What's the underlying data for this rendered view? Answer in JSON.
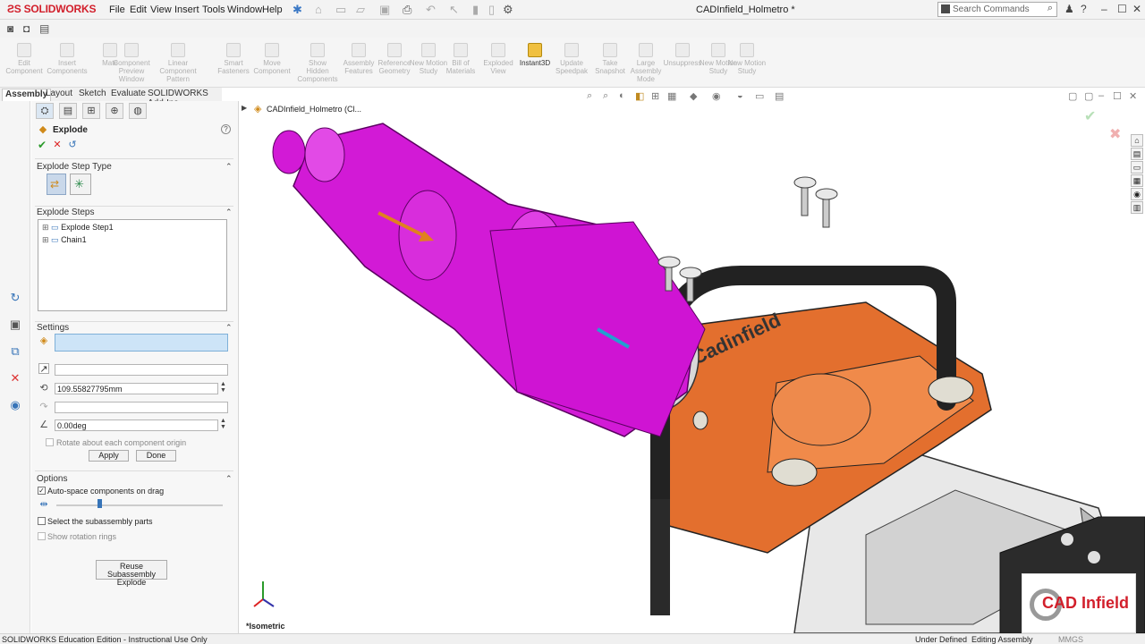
{
  "app": {
    "brand": "SOLIDWORKS",
    "menu": [
      "File",
      "Edit",
      "View",
      "Insert",
      "Tools",
      "Window",
      "Help"
    ],
    "doc_title": "CADInfield_Holmetro *",
    "search_placeholder": "Search Commands"
  },
  "command_bar": [
    {
      "label": "Edit Component",
      "active": false
    },
    {
      "label": "Insert Components",
      "active": false
    },
    {
      "label": "Mate",
      "active": false
    },
    {
      "label": "Component Preview Window",
      "active": false
    },
    {
      "label": "Linear Component Pattern",
      "active": false
    },
    {
      "label": "Smart Fasteners",
      "active": false
    },
    {
      "label": "Move Component",
      "active": false
    },
    {
      "label": "Show Hidden Components",
      "active": false
    },
    {
      "label": "Assembly Features",
      "active": false
    },
    {
      "label": "Reference Geometry",
      "active": false
    },
    {
      "label": "New Motion Study",
      "active": false
    },
    {
      "label": "Bill of Materials",
      "active": false
    },
    {
      "label": "Exploded View",
      "active": false
    },
    {
      "label": "Instant3D",
      "active": true
    },
    {
      "label": "Update Speedpak",
      "active": false
    },
    {
      "label": "Take Snapshot",
      "active": false
    },
    {
      "label": "Large Assembly Mode",
      "active": false
    },
    {
      "label": "Unsuppress",
      "active": false
    },
    {
      "label": "New Motion Study",
      "active": false
    },
    {
      "label": "New Motion Study",
      "active": false
    }
  ],
  "tabs": [
    "Assembly",
    "Layout",
    "Sketch",
    "Evaluate",
    "SOLIDWORKS Add-Ins"
  ],
  "property_manager": {
    "title": "Explode",
    "step_type_header": "Explode Step Type",
    "steps_header": "Explode Steps",
    "steps": [
      "Explode Step1",
      "Chain1"
    ],
    "settings_header": "Settings",
    "distance": "109.55827795mm",
    "angle": "0.00deg",
    "rotate_label": "Rotate about each component origin",
    "apply": "Apply",
    "done": "Done",
    "options_header": "Options",
    "auto_space": "Auto-space components on drag",
    "select_sub": "Select the subassembly parts",
    "show_rings": "Show rotation rings",
    "reuse_line1": "Reuse Subassembly",
    "reuse_line2": "Explode"
  },
  "viewport": {
    "tree_root": "CADInfield_Holmetro  (Cl...",
    "view_label": "*Isometric",
    "watermark_text": "CAD Infield",
    "brand_text": "Cadinfield"
  },
  "status": {
    "left": "SOLIDWORKS Education Edition - Instructional Use Only",
    "under_defined": "Under Defined",
    "editing": "Editing Assembly",
    "units": "MMGS"
  },
  "colors": {
    "magenta": "#d21ad6",
    "orange": "#e36f2e",
    "brand_red": "#d21f2b"
  }
}
